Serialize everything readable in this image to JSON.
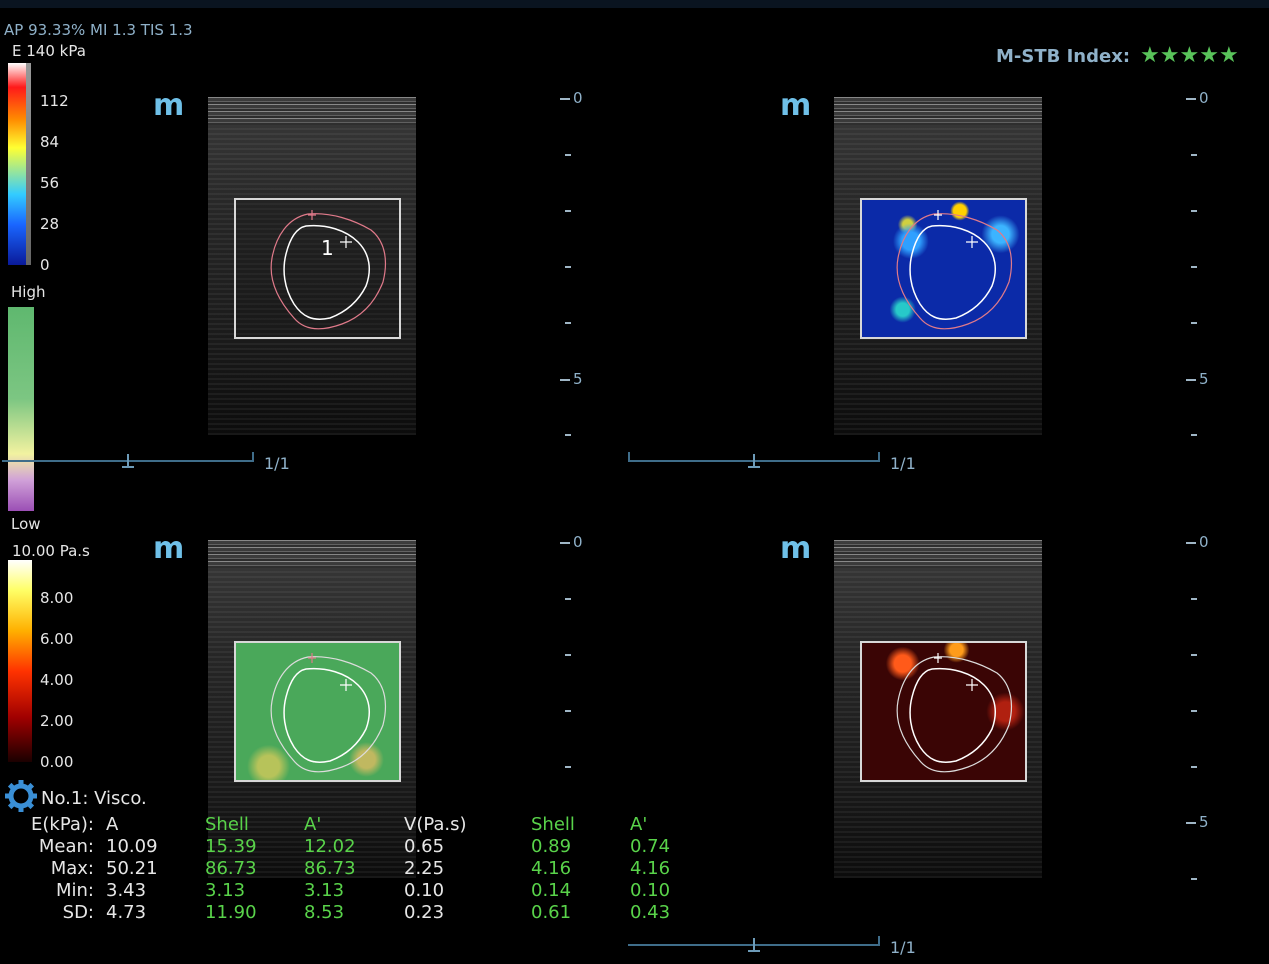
{
  "header": {
    "params": "AP 93.33%  MI 1.3 TIS 1.3",
    "stb_label": "M-STB Index:",
    "stb_stars": 5
  },
  "colorbars": {
    "elasticity": {
      "title": "E 140 kPa",
      "ticks": [
        "112",
        "84",
        "56",
        "28",
        "0"
      ]
    },
    "quality": {
      "high": "High",
      "low": "Low"
    },
    "viscosity": {
      "title": "10.00 Pa.s",
      "ticks": [
        "8.00",
        "6.00",
        "4.00",
        "2.00",
        "0.00"
      ]
    }
  },
  "panels": {
    "logo": "m",
    "depth_labels": [
      "0",
      "5"
    ],
    "frame_counter": "1/1",
    "roi_marker": "1"
  },
  "measurement": {
    "title": "No.1:  Visco.",
    "header": [
      "E(kPa):",
      "A",
      "Shell",
      "A'",
      "V(Pa.s)",
      "Shell",
      "A'"
    ],
    "rows": [
      [
        "Mean:",
        "10.09",
        "15.39",
        "12.02",
        "0.65",
        "0.89",
        "0.74"
      ],
      [
        "Max:",
        "50.21",
        "86.73",
        "86.73",
        "2.25",
        "4.16",
        "4.16"
      ],
      [
        "Min:",
        "3.43",
        "3.13",
        "3.13",
        "0.10",
        "0.14",
        "0.10"
      ],
      [
        "SD:",
        "4.73",
        "11.90",
        "8.53",
        "0.23",
        "0.61",
        "0.43"
      ]
    ]
  }
}
